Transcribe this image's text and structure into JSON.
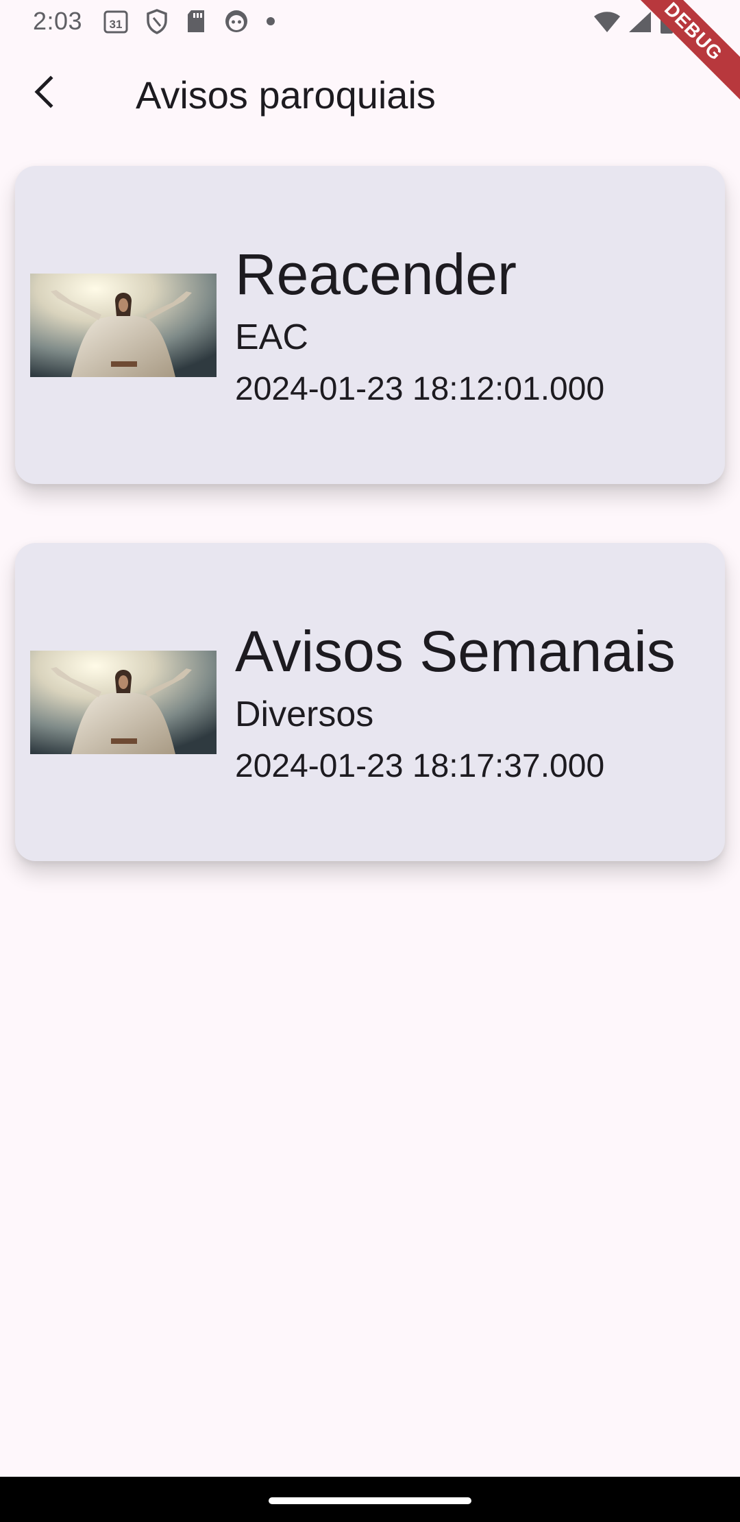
{
  "status_bar": {
    "time": "2:03",
    "calendar_day": "31",
    "left_icons": [
      "calendar-icon",
      "shield-icon",
      "sd-card-icon",
      "face-icon",
      "dot-icon"
    ],
    "right_icons": [
      "wifi-icon",
      "signal-icon",
      "battery-icon"
    ]
  },
  "debug_banner": "DEBUG",
  "app_bar": {
    "back_icon": "back-arrow-icon",
    "title": "Avisos paroquiais"
  },
  "cards": [
    {
      "title": "Reacender",
      "subtitle": "EAC",
      "date": "2024-01-23 18:12:01.000",
      "image": "jesus-image"
    },
    {
      "title": "Avisos Semanais",
      "subtitle": "Diversos",
      "date": "2024-01-23 18:17:37.000",
      "image": "jesus-image"
    }
  ],
  "colors": {
    "background": "#fef7fb",
    "card_background": "#e8e6f0",
    "text": "#1d1b20",
    "debug_ribbon": "#b8383d"
  }
}
